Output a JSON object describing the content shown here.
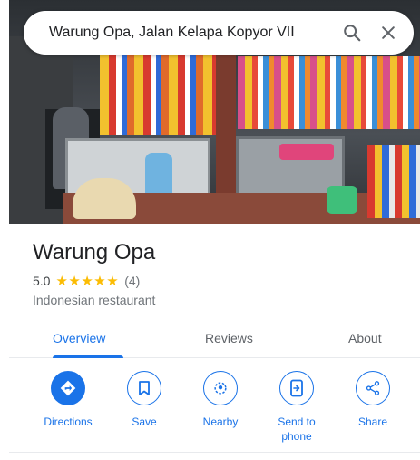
{
  "search": {
    "query": "Warung Opa, Jalan Kelapa Kopyor VII",
    "search_icon": "search-icon",
    "close_icon": "close-icon"
  },
  "place": {
    "name": "Warung Opa",
    "rating": "5.0",
    "stars": "★★★★★",
    "review_count": "(4)",
    "category": "Indonesian restaurant"
  },
  "tabs": [
    {
      "label": "Overview",
      "active": true
    },
    {
      "label": "Reviews",
      "active": false
    },
    {
      "label": "About",
      "active": false
    }
  ],
  "actions": [
    {
      "label": "Directions",
      "icon": "directions-icon"
    },
    {
      "label": "Save",
      "icon": "bookmark-icon"
    },
    {
      "label": "Nearby",
      "icon": "nearby-icon"
    },
    {
      "label": "Send to phone",
      "icon": "send-to-phone-icon"
    },
    {
      "label": "Share",
      "icon": "share-icon"
    }
  ],
  "colors": {
    "accent": "#1a73e8",
    "star": "#fbbc04",
    "secondary_text": "#70757a"
  }
}
